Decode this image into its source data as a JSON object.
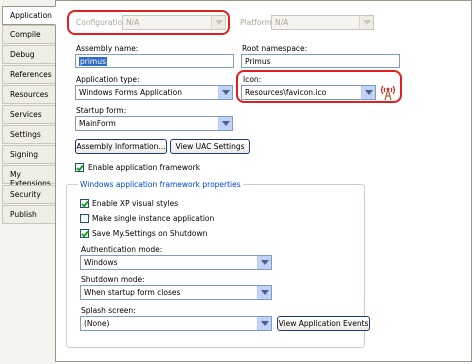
{
  "tabs": [
    {
      "label": "Application",
      "active": true
    },
    {
      "label": "Compile"
    },
    {
      "label": "Debug"
    },
    {
      "label": "References"
    },
    {
      "label": "Resources"
    },
    {
      "label": "Services"
    },
    {
      "label": "Settings"
    },
    {
      "label": "Signing"
    },
    {
      "label": "My Extensions"
    },
    {
      "label": "Security"
    },
    {
      "label": "Publish"
    }
  ],
  "header": {
    "configuration_label": "Configuration:",
    "configuration_value": "N/A",
    "platform_label": "Platform:",
    "platform_value": "N/A"
  },
  "assembly": {
    "name_label": "Assembly name:",
    "name_value": "primus",
    "root_ns_label": "Root namespace:",
    "root_ns_value": "Primus"
  },
  "app_type": {
    "label": "Application type:",
    "value": "Windows Forms Application"
  },
  "icon": {
    "label": "Icon:",
    "value": "Resources\\favicon.ico",
    "preview_icon": "broadcast-tower-icon"
  },
  "startup": {
    "label": "Startup form:",
    "value": "MainForm"
  },
  "buttons": {
    "assembly_info": "Assembly Information...",
    "uac": "View UAC Settings"
  },
  "framework": {
    "enable_label": "Enable application framework",
    "enable_checked": true
  },
  "group": {
    "title": "Windows application framework properties",
    "xp_styles": {
      "label": "Enable XP visual styles",
      "checked": true
    },
    "single_instance": {
      "label": "Make single instance application",
      "checked": false
    },
    "save_settings": {
      "label": "Save My.Settings on Shutdown",
      "checked": true
    },
    "auth_label": "Authentication mode:",
    "auth_value": "Windows",
    "shutdown_label": "Shutdown mode:",
    "shutdown_value": "When startup form closes",
    "splash_label": "Splash screen:",
    "splash_value": "(None)",
    "view_events_button": "View Application Events"
  },
  "colors": {
    "highlight": "#e02020",
    "selection": "#316ac5",
    "tab_strip": "#f4f3ee"
  }
}
